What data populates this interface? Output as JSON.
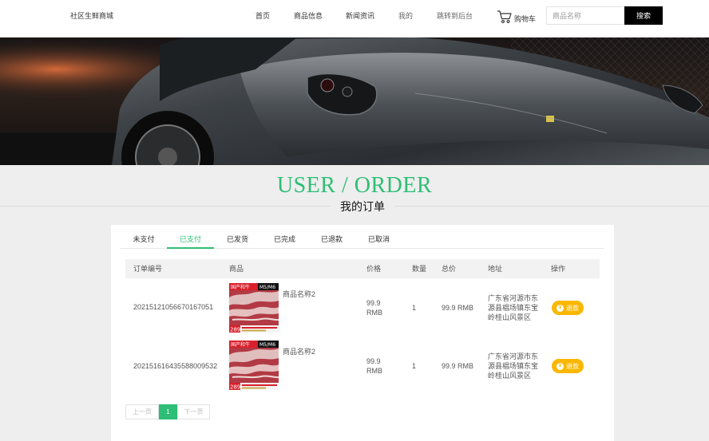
{
  "header": {
    "brand": "社区生鲜商城",
    "nav": [
      {
        "label": "首页"
      },
      {
        "label": "商品信息"
      },
      {
        "label": "新闻资讯"
      },
      {
        "label": "我的"
      },
      {
        "label": "跳转到后台"
      }
    ],
    "cart_label": "购物车",
    "search_placeholder": "商品名称",
    "search_button": "搜索"
  },
  "page": {
    "title_en": "USER / ORDER",
    "title_cn": "我的订单"
  },
  "tabs": [
    {
      "label": "未支付"
    },
    {
      "label": "已支付",
      "active": true
    },
    {
      "label": "已发货"
    },
    {
      "label": "已完成"
    },
    {
      "label": "已退款"
    },
    {
      "label": "已取消"
    }
  ],
  "table": {
    "headers": [
      "订单编号",
      "商品",
      "价格",
      "数量",
      "总价",
      "地址",
      "操作"
    ],
    "rows": [
      {
        "order_no": "20215121056670167051",
        "product_name": "商品名称2",
        "price_line1": "99.9",
        "price_line2": "RMB",
        "quantity": "1",
        "total": "99.9 RMB",
        "address_line1": "广东省河源市东",
        "address_line2": "源县椙场镇东宝",
        "address_line3": "岭桂山风景区",
        "action": "退款"
      },
      {
        "order_no": "20215161643558800953​2",
        "product_name": "商品名称2",
        "price_line1": "99.9",
        "price_line2": "RMB",
        "quantity": "1",
        "total": "99.9 RMB",
        "address_line1": "广东省河源市东",
        "address_line2": "源县椙场镇东宝",
        "address_line3": "岭桂山风景区",
        "action": "退款"
      }
    ]
  },
  "product_image": {
    "badge_left": "国产和牛",
    "badge_right": "M5/M6",
    "price_tag": "289"
  },
  "pager": {
    "prev": "上一页",
    "current": "1",
    "next": "下一页"
  },
  "colors": {
    "accent": "#2ebe75",
    "refund": "#fab700"
  }
}
